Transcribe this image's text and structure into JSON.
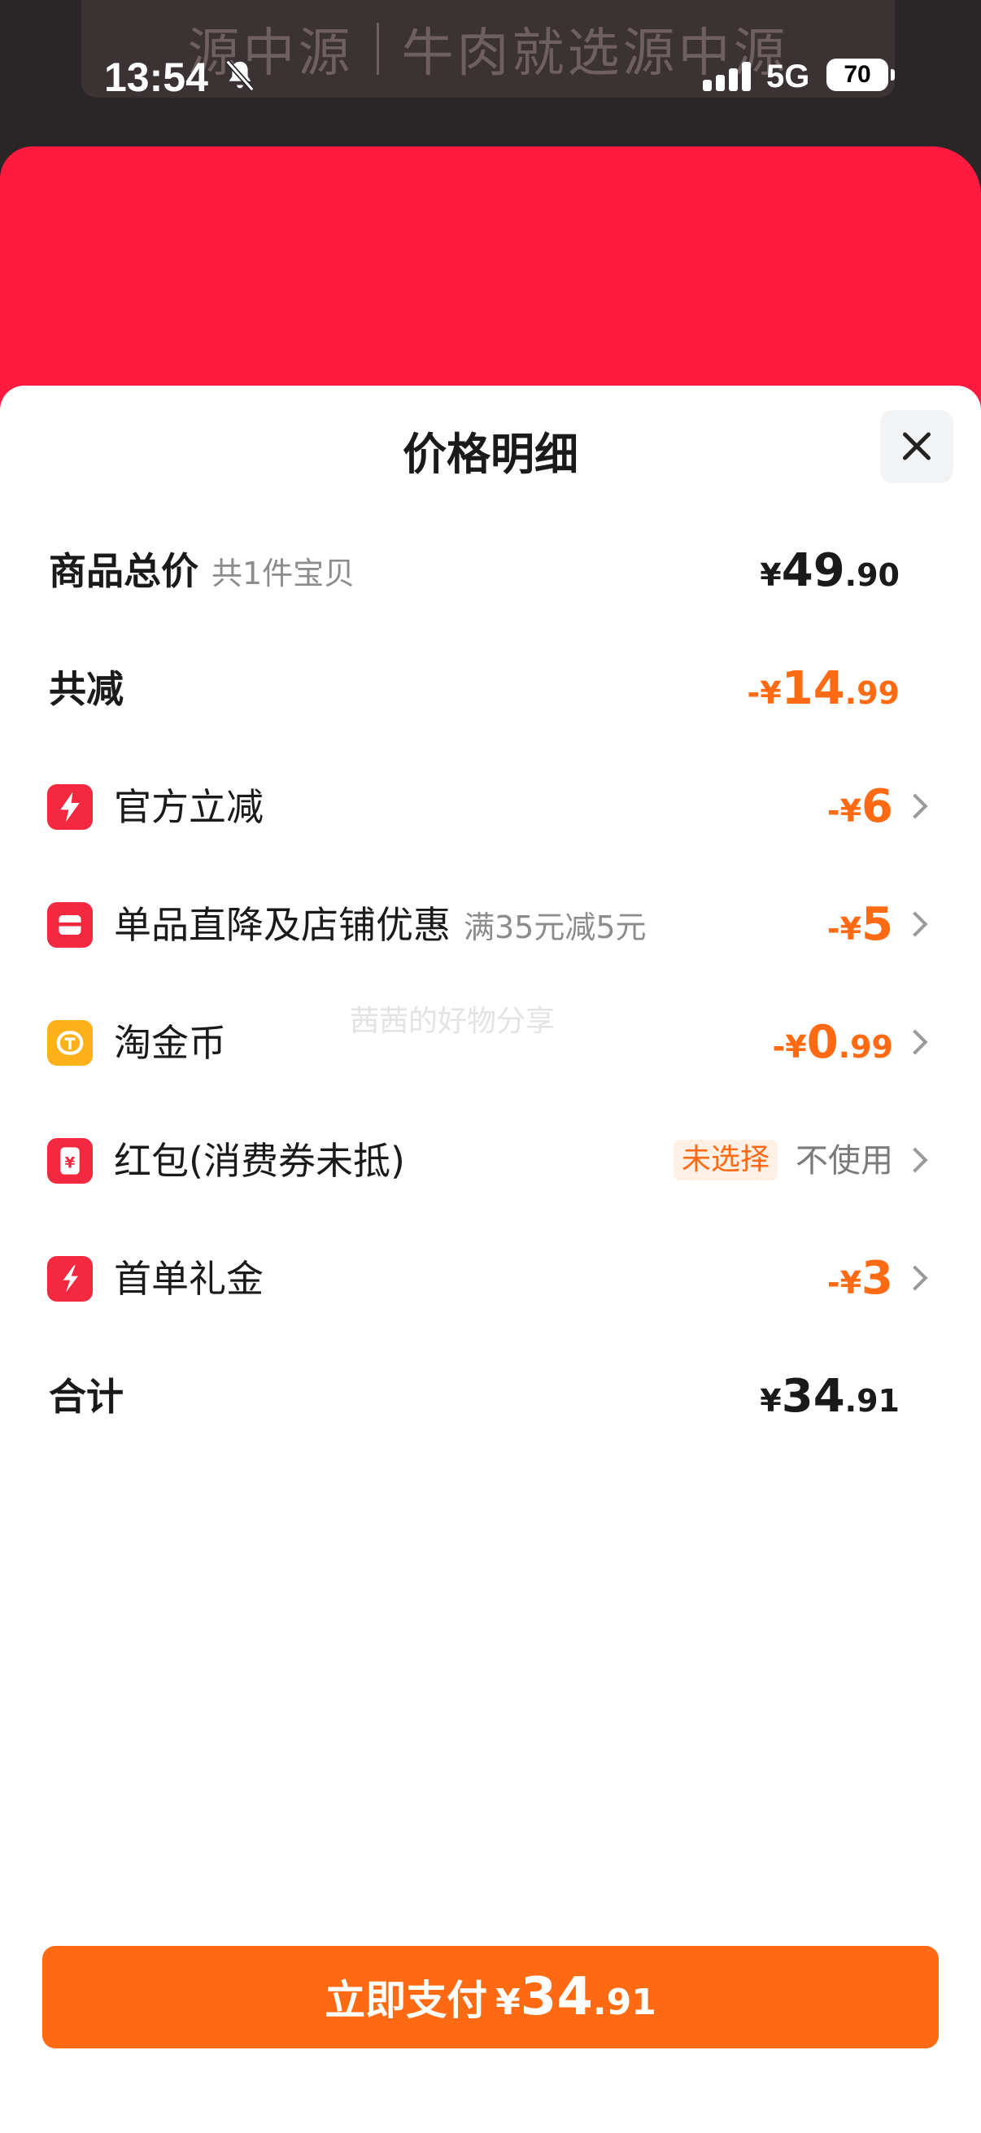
{
  "background": {
    "banner_brand": "源中源",
    "banner_slogan": "牛肉就选源中源"
  },
  "status_bar": {
    "time": "13:54",
    "network": "5G",
    "battery": "70"
  },
  "sheet": {
    "title": "价格明细",
    "rows": {
      "total": {
        "label": "商品总价",
        "sub": "共1件宝贝",
        "sign": "¥",
        "int": "49",
        "dec": ".90"
      },
      "discount": {
        "label": "共减",
        "sign": "-¥",
        "int": "14",
        "dec": ".99"
      },
      "official": {
        "label": "官方立减",
        "sign": "-¥",
        "int": "6",
        "dec": ""
      },
      "single": {
        "label": "单品直降及店铺优惠",
        "sub": "满35元减5元",
        "sign": "-¥",
        "int": "5",
        "dec": ""
      },
      "coins": {
        "label": "淘金币",
        "sign": "-¥",
        "int": "0",
        "dec": ".99"
      },
      "redpacket": {
        "label": "红包(消费券未抵)",
        "tag": "未选择",
        "value": "不使用"
      },
      "firstorder": {
        "label": "首单礼金",
        "sign": "-¥",
        "int": "3",
        "dec": ""
      },
      "sum": {
        "label": "合计",
        "sign": "¥",
        "int": "34",
        "dec": ".91"
      }
    },
    "watermark": "茜茜的好物分享"
  },
  "pay_button": {
    "label": "立即支付",
    "sign": "¥",
    "int": "34",
    "dec": ".91"
  },
  "colors": {
    "accent": "#ff6a13",
    "icon_red": "#f4283f",
    "icon_yellow": "#ffb11a"
  }
}
